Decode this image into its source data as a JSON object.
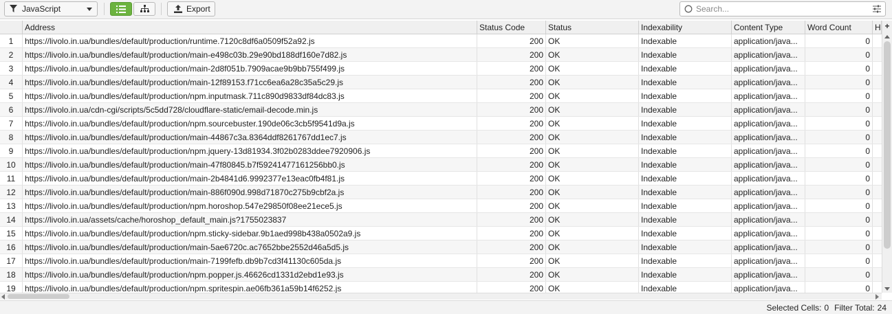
{
  "toolbar": {
    "filter_label": "JavaScript",
    "export_label": "Export",
    "search_placeholder": "Search...",
    "accent_color": "#6cb33f"
  },
  "table": {
    "columns": [
      "",
      "Address",
      "Status Code",
      "Status",
      "Indexability",
      "Content Type",
      "Word Count",
      "H"
    ],
    "rows": [
      [
        "1",
        "https://livolo.in.ua/bundles/default/production/runtime.7120c8df6a0509f52a92.js",
        "200",
        "OK",
        "Indexable",
        "application/java...",
        "0"
      ],
      [
        "2",
        "https://livolo.in.ua/bundles/default/production/main-e498c03b.29e90bd188df160e7d82.js",
        "200",
        "OK",
        "Indexable",
        "application/java...",
        "0"
      ],
      [
        "3",
        "https://livolo.in.ua/bundles/default/production/main-2d8f051b.7909acae9b9bb755f499.js",
        "200",
        "OK",
        "Indexable",
        "application/java...",
        "0"
      ],
      [
        "4",
        "https://livolo.in.ua/bundles/default/production/main-12f89153.f71cc6ea6a28c35a5c29.js",
        "200",
        "OK",
        "Indexable",
        "application/java...",
        "0"
      ],
      [
        "5",
        "https://livolo.in.ua/bundles/default/production/npm.inputmask.711c890d9833df84dc83.js",
        "200",
        "OK",
        "Indexable",
        "application/java...",
        "0"
      ],
      [
        "6",
        "https://livolo.in.ua/cdn-cgi/scripts/5c5dd728/cloudflare-static/email-decode.min.js",
        "200",
        "OK",
        "Indexable",
        "application/java...",
        "0"
      ],
      [
        "7",
        "https://livolo.in.ua/bundles/default/production/npm.sourcebuster.190de06c3cb5f9541d9a.js",
        "200",
        "OK",
        "Indexable",
        "application/java...",
        "0"
      ],
      [
        "8",
        "https://livolo.in.ua/bundles/default/production/main-44867c3a.8364ddf8261767dd1ec7.js",
        "200",
        "OK",
        "Indexable",
        "application/java...",
        "0"
      ],
      [
        "9",
        "https://livolo.in.ua/bundles/default/production/npm.jquery-13d81934.3f02b0283ddee7920906.js",
        "200",
        "OK",
        "Indexable",
        "application/java...",
        "0"
      ],
      [
        "10",
        "https://livolo.in.ua/bundles/default/production/main-47f80845.b7f59241477161256bb0.js",
        "200",
        "OK",
        "Indexable",
        "application/java...",
        "0"
      ],
      [
        "11",
        "https://livolo.in.ua/bundles/default/production/main-2b4841d6.9992377e13eac0fb4f81.js",
        "200",
        "OK",
        "Indexable",
        "application/java...",
        "0"
      ],
      [
        "12",
        "https://livolo.in.ua/bundles/default/production/main-886f090d.998d71870c275b9cbf2a.js",
        "200",
        "OK",
        "Indexable",
        "application/java...",
        "0"
      ],
      [
        "13",
        "https://livolo.in.ua/bundles/default/production/npm.horoshop.547e29850f08ee21ece5.js",
        "200",
        "OK",
        "Indexable",
        "application/java...",
        "0"
      ],
      [
        "14",
        "https://livolo.in.ua/assets/cache/horoshop_default_main.js?1755023837",
        "200",
        "OK",
        "Indexable",
        "application/java...",
        "0"
      ],
      [
        "15",
        "https://livolo.in.ua/bundles/default/production/npm.sticky-sidebar.9b1aed998b438a0502a9.js",
        "200",
        "OK",
        "Indexable",
        "application/java...",
        "0"
      ],
      [
        "16",
        "https://livolo.in.ua/bundles/default/production/main-5ae6720c.ac7652bbe2552d46a5d5.js",
        "200",
        "OK",
        "Indexable",
        "application/java...",
        "0"
      ],
      [
        "17",
        "https://livolo.in.ua/bundles/default/production/main-7199fefb.db9b7cd3f41130c605da.js",
        "200",
        "OK",
        "Indexable",
        "application/java...",
        "0"
      ],
      [
        "18",
        "https://livolo.in.ua/bundles/default/production/npm.popper.js.46626cd1331d2ebd1e93.js",
        "200",
        "OK",
        "Indexable",
        "application/java...",
        "0"
      ],
      [
        "19",
        "https://livolo.in.ua/bundles/default/production/npm.spritespin.ae06fb361a59b14f6252.js",
        "200",
        "OK",
        "Indexable",
        "application/java...",
        "0"
      ]
    ]
  },
  "status_bar": {
    "selected_cells_label": "Selected Cells:",
    "selected_cells_value": "0",
    "filter_total_label": "Filter Total:",
    "filter_total_value": "24"
  }
}
